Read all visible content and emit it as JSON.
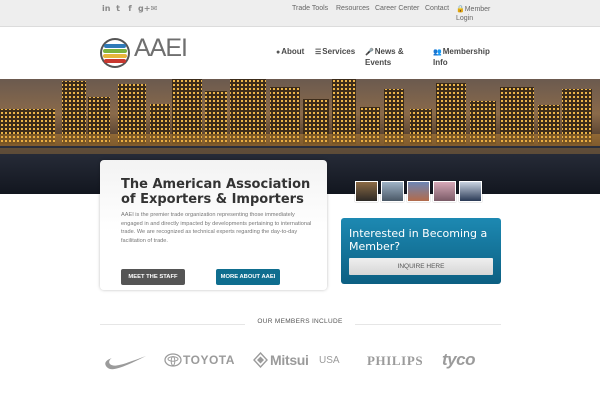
{
  "topbar": {
    "social_icons": [
      "linkedin-icon",
      "twitter-icon",
      "facebook-icon",
      "google-plus-icon",
      "email-icon"
    ],
    "links": [
      "Trade Tools",
      "Resources",
      "Career Center",
      "Contact"
    ],
    "member_login": "Member Login"
  },
  "header": {
    "logo_text": "AAEI",
    "nav": [
      {
        "icon": "globe-icon",
        "label": "About"
      },
      {
        "icon": "list-icon",
        "label": "Services"
      },
      {
        "icon": "microphone-icon",
        "label": "News & Events"
      },
      {
        "icon": "users-icon",
        "label": "Membership Info"
      }
    ]
  },
  "hero": {
    "card": {
      "title": "The American Association of Exporters & Importers",
      "body": "AAEI is the premier trade organization representing those immediately engaged in and directly impacted by developments pertaining to international trade. We are recognized as technical experts regarding the day-to-day facilitation of trade.",
      "btn_staff": "MEET THE STAFF",
      "btn_more": "MORE ABOUT AAEI"
    }
  },
  "membership_box": {
    "title": "Interested in Becoming a Member?",
    "button": "INQUIRE HERE"
  },
  "members": {
    "heading": "OUR MEMBERS INCLUDE",
    "logos": [
      "TOYOTA",
      "Mitsui",
      "USA",
      "PHILIPS",
      "tyco"
    ]
  },
  "colors": {
    "accent_blue": "#0f6e8f",
    "dark_button": "#555555",
    "topbar_bg": "#eeeeee"
  }
}
